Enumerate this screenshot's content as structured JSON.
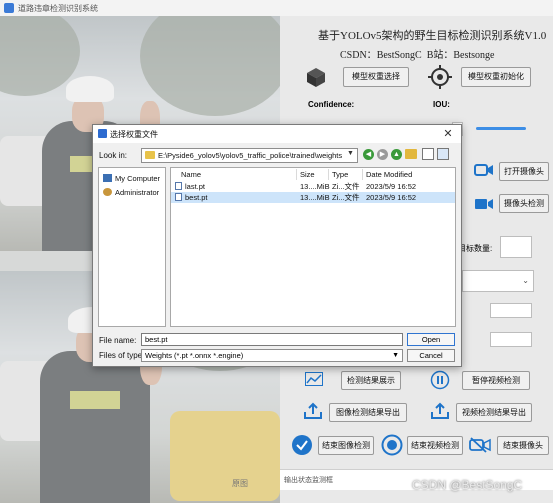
{
  "window": {
    "title": "道路违章检测识别系统"
  },
  "right": {
    "heading": "基于YOLOv5架构的野生目标检测识别系统V1.0",
    "csdn_label": "CSDN：",
    "csdn_value": "BestSongC",
    "bili_label": "B站：",
    "bili_value": "Bestsonge",
    "btn_model_select": "模型权重选择",
    "btn_model_init": "模型权重初始化",
    "confidence_label": "Confidence:",
    "iou_label": "IOU:",
    "btn_open_camera": "打开摄像头",
    "btn_camera_detect": "摄像头检测",
    "target_count_label": "目标数量:",
    "btn_show_result": "检测结果展示",
    "btn_pause_video": "暂停视频检测",
    "btn_export_image": "图像检测结果导出",
    "btn_export_video": "视频检测结果导出",
    "btn_end_image": "结束图像检测",
    "btn_end_video": "结束视频检测",
    "btn_end_camera": "结束摄像头",
    "status_text": "输出状态监测框",
    "spin_arrows": "▲▼",
    "left_watermark": "原图"
  },
  "dialog": {
    "title": "选择权重文件",
    "look_in_label": "Look in:",
    "look_in_path": "E:\\Pyside6_yolov5\\yolov5_traffic_police\\trained\\weights",
    "places": [
      "My Computer",
      "Administrator"
    ],
    "columns": [
      "Name",
      "Size",
      "Type",
      "Date Modified"
    ],
    "files": [
      {
        "name": "last.pt",
        "size": "13....MiB",
        "type": "Zi...文件",
        "date": "2023/5/9 16:52",
        "selected": false
      },
      {
        "name": "best.pt",
        "size": "13....MiB",
        "type": "Zi...文件",
        "date": "2023/5/9 16:52",
        "selected": true
      }
    ],
    "file_name_label": "File name:",
    "file_name_value": "best.pt",
    "file_type_label": "Files of type:",
    "file_type_value": "Weights (*.pt *.onnx *.engine)",
    "open_label": "Open",
    "cancel_label": "Cancel"
  },
  "watermark": "CSDN @BestSongC",
  "colors": {
    "accent": "#2f74d0",
    "icon_blue": "#1f74c9",
    "selected_row": "#cde4fa"
  }
}
